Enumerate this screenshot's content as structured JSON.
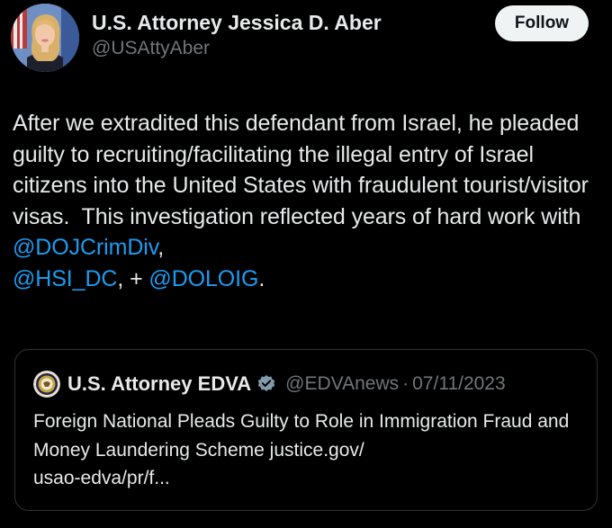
{
  "author": {
    "display_name": "U.S. Attorney Jessica D. Aber",
    "handle": "@USAttyAber",
    "avatar_icon": "profile-photo"
  },
  "follow_button": {
    "label": "Follow"
  },
  "tweet": {
    "text_part1": "After we extradited this defendant from Israel, he pleaded guilty to recruiting/facilitating the illegal entry of Israel citizens into the United States with fraudulent tourist/visitor visas.  This investigation reflected years of hard work with ",
    "mention1": "@DOJCrimDiv",
    "text_part2": ",\n",
    "mention2": "@HSI_DC",
    "text_part3": ", + ",
    "mention3": "@DOLOIG",
    "text_part4": "."
  },
  "quoted_tweet": {
    "display_name": "U.S. Attorney EDVA",
    "verified_icon": "verified-badge-icon",
    "handle": "@EDVAnews",
    "separator": "·",
    "date": "07/11/2023",
    "text": "Foreign National Pleads Guilty to Role in Immigration Fraud and Money Laundering Scheme justice.gov/\nusao-edva/pr/f..."
  },
  "colors": {
    "background": "#000000",
    "text_primary": "#e7e9ea",
    "text_secondary": "#71767b",
    "link": "#1d9bf0",
    "border": "#2f3336",
    "button_bg": "#eff3f4"
  }
}
